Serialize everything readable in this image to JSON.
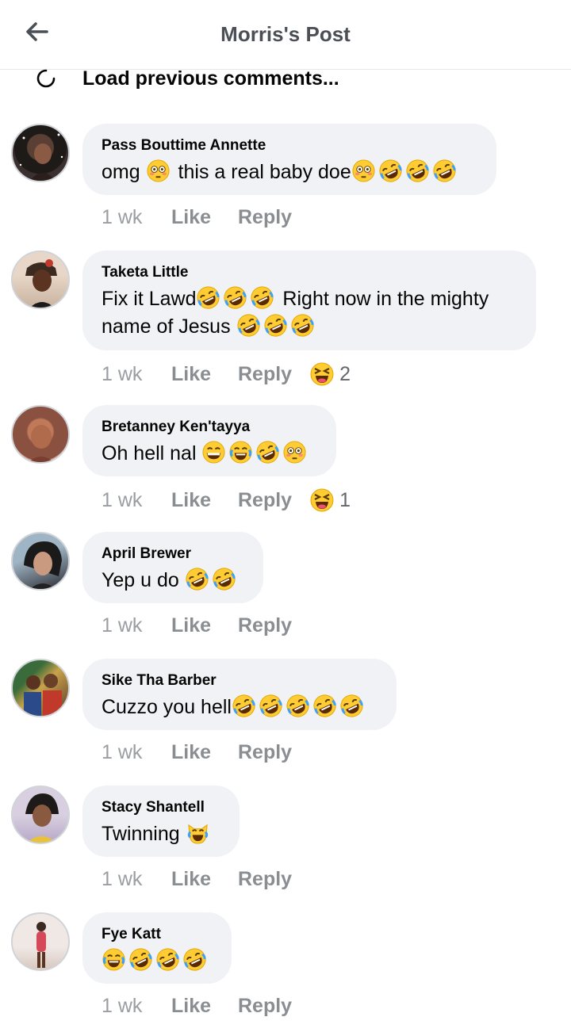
{
  "header": {
    "title": "Morris's Post",
    "back_icon": "back-arrow-icon"
  },
  "load_previous": {
    "label": "Load previous comments..."
  },
  "actions": {
    "like_label": "Like",
    "reply_label": "Reply"
  },
  "comments": [
    {
      "author": "Pass Bouttime Annette",
      "lines": [
        "omg  this a real baby doe"
      ],
      "time": "1 wk",
      "reaction_count": null
    },
    {
      "author": "Taketa Little",
      "lines": [
        "Fix  it Lawd   Right now in the mighty",
        "name of Jesus"
      ],
      "time": "1 wk",
      "reaction_count": "2"
    },
    {
      "author": "Bretanney Ken'tayya",
      "lines": [
        "Oh hell nal"
      ],
      "time": "1 wk",
      "reaction_count": "1"
    },
    {
      "author": "April Brewer",
      "lines": [
        "Yep u do"
      ],
      "time": "1 wk",
      "reaction_count": null
    },
    {
      "author": "Sike Tha Barber",
      "lines": [
        "Cuzzo you hell"
      ],
      "time": "1 wk",
      "reaction_count": null
    },
    {
      "author": "Stacy Shantell",
      "lines": [
        "Twinning"
      ],
      "time": "1 wk",
      "reaction_count": null
    },
    {
      "author": "Fye Katt",
      "lines": [
        ""
      ],
      "time": "1 wk",
      "reaction_count": null
    }
  ],
  "colors": {
    "bubble": "#f0f2f5",
    "meta": "#8a8d91",
    "emoji": "#ffcc33"
  }
}
